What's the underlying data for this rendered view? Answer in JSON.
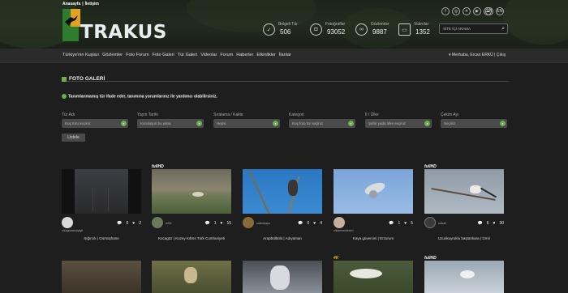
{
  "header": {
    "top_links": [
      "Anasayfa",
      "|",
      "İletişim"
    ],
    "logo_text": "TRAKUS",
    "social": [
      "f",
      "◎",
      "✕",
      "▶",
      "☁"
    ],
    "languages": [
      "TR",
      "EN"
    ],
    "stats": [
      {
        "label": "Belgeli Tür",
        "value": "506",
        "icon": "checkmark-icon"
      },
      {
        "label": "Fotoğraflar",
        "value": "93052",
        "icon": "camera-icon"
      },
      {
        "label": "Gözlemler",
        "value": "9887",
        "icon": "binoculars-icon"
      },
      {
        "label": "Videolar",
        "value": "1352",
        "icon": "video-icon"
      }
    ],
    "search_placeholder": "SİTE İÇİ ARAMA"
  },
  "nav": {
    "items": [
      "Türkiye'nin Kuşları",
      "Gözlemler",
      "Foto Forum",
      "Foto Galeri",
      "Tür Galeri",
      "Videolar",
      "Forum",
      "Haberler",
      "Etkinlikler",
      "İlanlar"
    ],
    "user": "▾ Merhaba, Ercan ERKÜ | Çıkış"
  },
  "section": {
    "title": "FOTO GALERİ",
    "info": "Tanımlanmamış tür ifade eder, tanımına yorumlarınız ile yardımcı olabilirsiniz."
  },
  "filters": [
    {
      "label": "Tür Adı",
      "placeholder": "Kuş türü seçiniz"
    },
    {
      "label": "Yayın Tarihi",
      "placeholder": "Kuruluşun bu yana"
    },
    {
      "label": "Sıralama / Kalite",
      "placeholder": "Hepsi"
    },
    {
      "label": "Kategori",
      "placeholder": "Kuş foto tür seçiniz"
    },
    {
      "label": "İl / Ülke",
      "placeholder": "Şehir yada ülke seçiniz"
    },
    {
      "label": "Çekim Ayı",
      "placeholder": "Seçiniz"
    }
  ],
  "list_button": "Listele",
  "cards": [
    {
      "badge": "",
      "user": "mkagorkanyiyigit",
      "comments": "0",
      "likes": "2",
      "caption": "Sığırcık     | Gümüşhane"
    },
    {
      "badge": "fullHD",
      "user": "AZM",
      "comments": "1",
      "likes": "15",
      "caption": "Kocagöz     | Kuzey Kıbrıs Türk Cumhuriyeti"
    },
    {
      "badge": "",
      "user": "sakirsbaya",
      "comments": "0",
      "likes": "4",
      "caption": "Arapbülbülü     | Adıyaman"
    },
    {
      "badge": "",
      "user": "olkanmenkesen",
      "comments": "1",
      "likes": "5",
      "caption": "Kaya güvercini     | Erzurum"
    },
    {
      "badge": "fullHD",
      "user": "salsalr",
      "comments": "6",
      "likes": "30",
      "caption": "Uzunkuyruklu baştankara     | İzmir"
    }
  ],
  "bottom_badges": [
    "",
    "",
    "",
    "4K",
    "fullHD"
  ]
}
